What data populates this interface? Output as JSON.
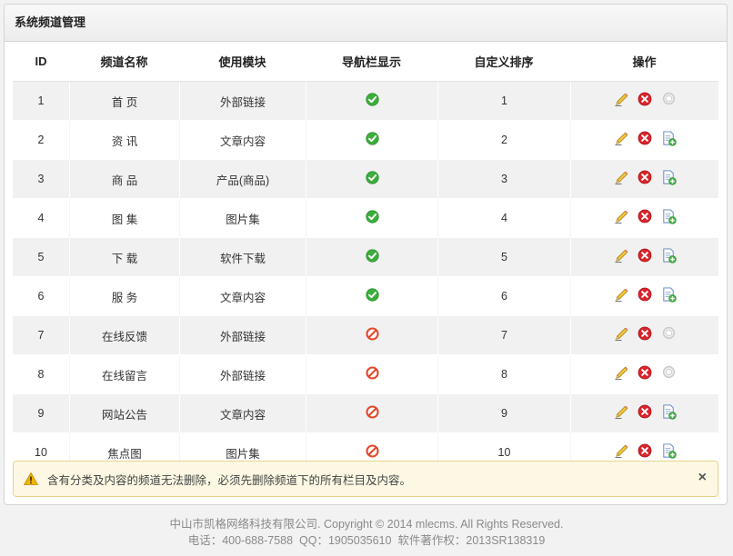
{
  "panel": {
    "title": "系统频道管理"
  },
  "table": {
    "headers": [
      "ID",
      "频道名称",
      "使用模块",
      "导航栏显示",
      "自定义排序",
      "操作"
    ],
    "rows": [
      {
        "id": "1",
        "name": "首 页",
        "module": "外部链接",
        "nav": "yes",
        "sort": "1",
        "third_action": "disabled"
      },
      {
        "id": "2",
        "name": "资 讯",
        "module": "文章内容",
        "nav": "yes",
        "sort": "2",
        "third_action": "add"
      },
      {
        "id": "3",
        "name": "商 品",
        "module": "产品(商品)",
        "nav": "yes",
        "sort": "3",
        "third_action": "add"
      },
      {
        "id": "4",
        "name": "图 集",
        "module": "图片集",
        "nav": "yes",
        "sort": "4",
        "third_action": "add"
      },
      {
        "id": "5",
        "name": "下 载",
        "module": "软件下载",
        "nav": "yes",
        "sort": "5",
        "third_action": "add"
      },
      {
        "id": "6",
        "name": "服 务",
        "module": "文章内容",
        "nav": "yes",
        "sort": "6",
        "third_action": "add"
      },
      {
        "id": "7",
        "name": "在线反馈",
        "module": "外部链接",
        "nav": "no",
        "sort": "7",
        "third_action": "disabled"
      },
      {
        "id": "8",
        "name": "在线留言",
        "module": "外部链接",
        "nav": "no",
        "sort": "8",
        "third_action": "disabled"
      },
      {
        "id": "9",
        "name": "网站公告",
        "module": "文章内容",
        "nav": "no",
        "sort": "9",
        "third_action": "add"
      },
      {
        "id": "10",
        "name": "焦点图",
        "module": "图片集",
        "nav": "no",
        "sort": "10",
        "third_action": "add"
      }
    ],
    "icons": {
      "edit": "pencil-icon",
      "delete": "delete-icon",
      "add": "add-content-icon",
      "disabled": "disabled-circle-icon",
      "nav_yes": "check-circle-icon",
      "nav_no": "forbidden-icon"
    }
  },
  "alert": {
    "text": "含有分类及内容的频道无法删除，必须先删除频道下的所有栏目及内容。",
    "close": "×"
  },
  "footer": {
    "line1": "中山市凯格网络科技有限公司. Copyright © 2014 mlecms. All Rights Reserved.",
    "line2": "电话：400-688-7588  QQ：1905035610  软件著作权：2013SR138319"
  },
  "colors": {
    "check": "#3cae3c",
    "forbid": "#e34a2a",
    "delete": "#d9252b",
    "alert_bg": "#fcf8e3"
  }
}
